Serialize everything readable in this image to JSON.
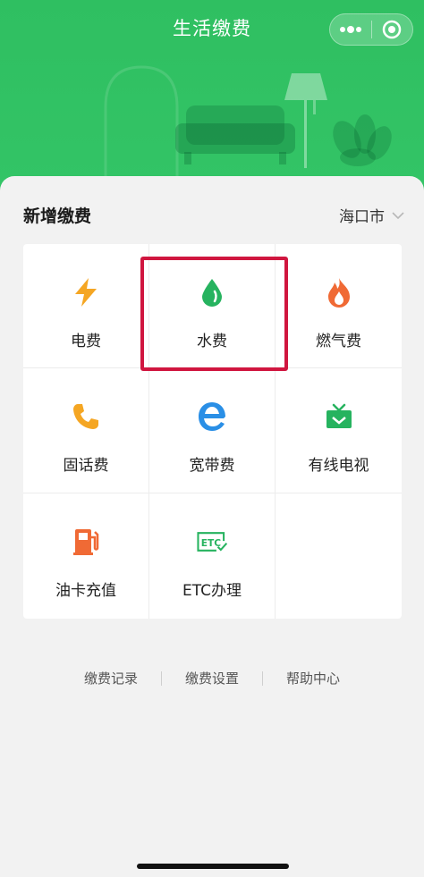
{
  "nav": {
    "title": "生活缴费",
    "capsule_more_icon": "more-dots-icon",
    "capsule_close_icon": "target-close-icon"
  },
  "section": {
    "title": "新增缴费",
    "city": "海口市",
    "city_icon": "chevron-down-icon"
  },
  "services": [
    {
      "label": "电费",
      "icon": "lightning-icon",
      "color": "#f5a623"
    },
    {
      "label": "水费",
      "icon": "water-drop-icon",
      "color": "#26b35f"
    },
    {
      "label": "燃气费",
      "icon": "flame-icon",
      "color": "#f06a35"
    },
    {
      "label": "固话费",
      "icon": "phone-icon",
      "color": "#f5a623"
    },
    {
      "label": "宽带费",
      "icon": "browser-e-icon",
      "color": "#2a8fe6"
    },
    {
      "label": "有线电视",
      "icon": "tv-icon",
      "color": "#26b35f"
    },
    {
      "label": "油卡充值",
      "icon": "fuel-pump-icon",
      "color": "#f06a35"
    },
    {
      "label": "ETC办理",
      "icon": "etc-icon",
      "color": "#26b35f"
    }
  ],
  "footer": {
    "records": "缴费记录",
    "settings": "缴费设置",
    "help": "帮助中心"
  },
  "colors": {
    "header_green": "#33c466",
    "highlight_red": "#d0163f"
  }
}
